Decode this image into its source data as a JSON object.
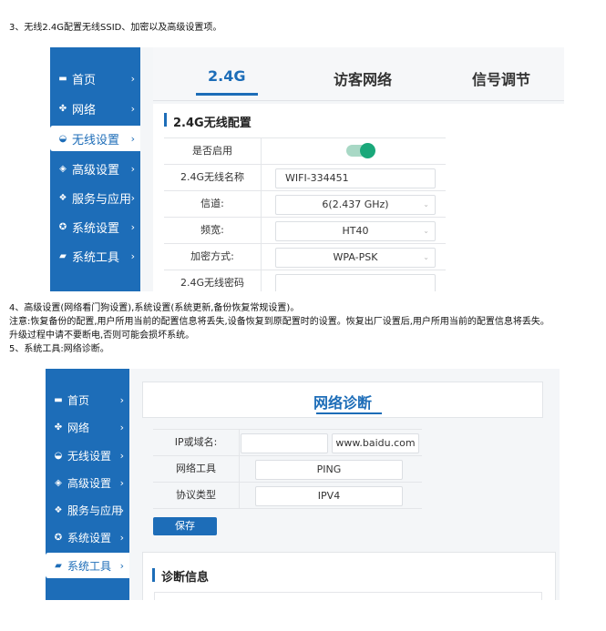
{
  "doc": {
    "line1": "3、无线2.4G配置无线SSID、加密以及高级设置项。",
    "line4": "4、高级设置(网络看门狗设置),系统设置(系统更新,备份恢复常规设置)。",
    "note1": "注意:恢复备份的配置,用户所用当前的配置信息将丢失,设备恢复到原配置时的设置。恢复出厂设置后,用户所用当前的配置信息将丢失。",
    "note2": "升级过程中请不要断电,否则可能会损坏系统。",
    "line5": "5、系统工具:网络诊断。"
  },
  "sidebar": {
    "items": [
      {
        "label": "首页",
        "icon": "home-icon",
        "glyph": "▬"
      },
      {
        "label": "网络",
        "icon": "network-icon",
        "glyph": "✤"
      },
      {
        "label": "无线设置",
        "icon": "wifi-icon",
        "glyph": "◒"
      },
      {
        "label": "高级设置",
        "icon": "layers-icon",
        "glyph": "◈"
      },
      {
        "label": "服务与应用",
        "icon": "cube-icon",
        "glyph": "❖"
      },
      {
        "label": "系统设置",
        "icon": "gear-icon",
        "glyph": "✪"
      },
      {
        "label": "系统工具",
        "icon": "toolbox-icon",
        "glyph": "▰"
      }
    ],
    "chevron": "›"
  },
  "wireless": {
    "tabs": [
      "2.4G",
      "访客网络",
      "信号调节"
    ],
    "section_title": "2.4G无线配置",
    "rows": {
      "enable_label": "是否启用",
      "ssid_label": "2.4G无线名称",
      "ssid_value": "WIFI-334451",
      "channel_label": "信道:",
      "channel_value": "6(2.437 GHz)",
      "bandwidth_label": "频宽:",
      "bandwidth_value": "HT40",
      "encryption_label": "加密方式:",
      "encryption_value": "WPA-PSK",
      "password_label": "2.4G无线密码",
      "password_value": ""
    }
  },
  "diagnostics": {
    "title": "网络诊断",
    "ip_label": "IP或域名:",
    "ip_value": "",
    "ip_example": "www.baidu.com",
    "tool_label": "网络工具",
    "tool_value": "PING",
    "protocol_label": "协议类型",
    "protocol_value": "IPV4",
    "save_label": "保存",
    "info_title": "诊断信息"
  },
  "colors": {
    "brand": "#1d6db8",
    "toggle_on": "#1aa87a"
  }
}
